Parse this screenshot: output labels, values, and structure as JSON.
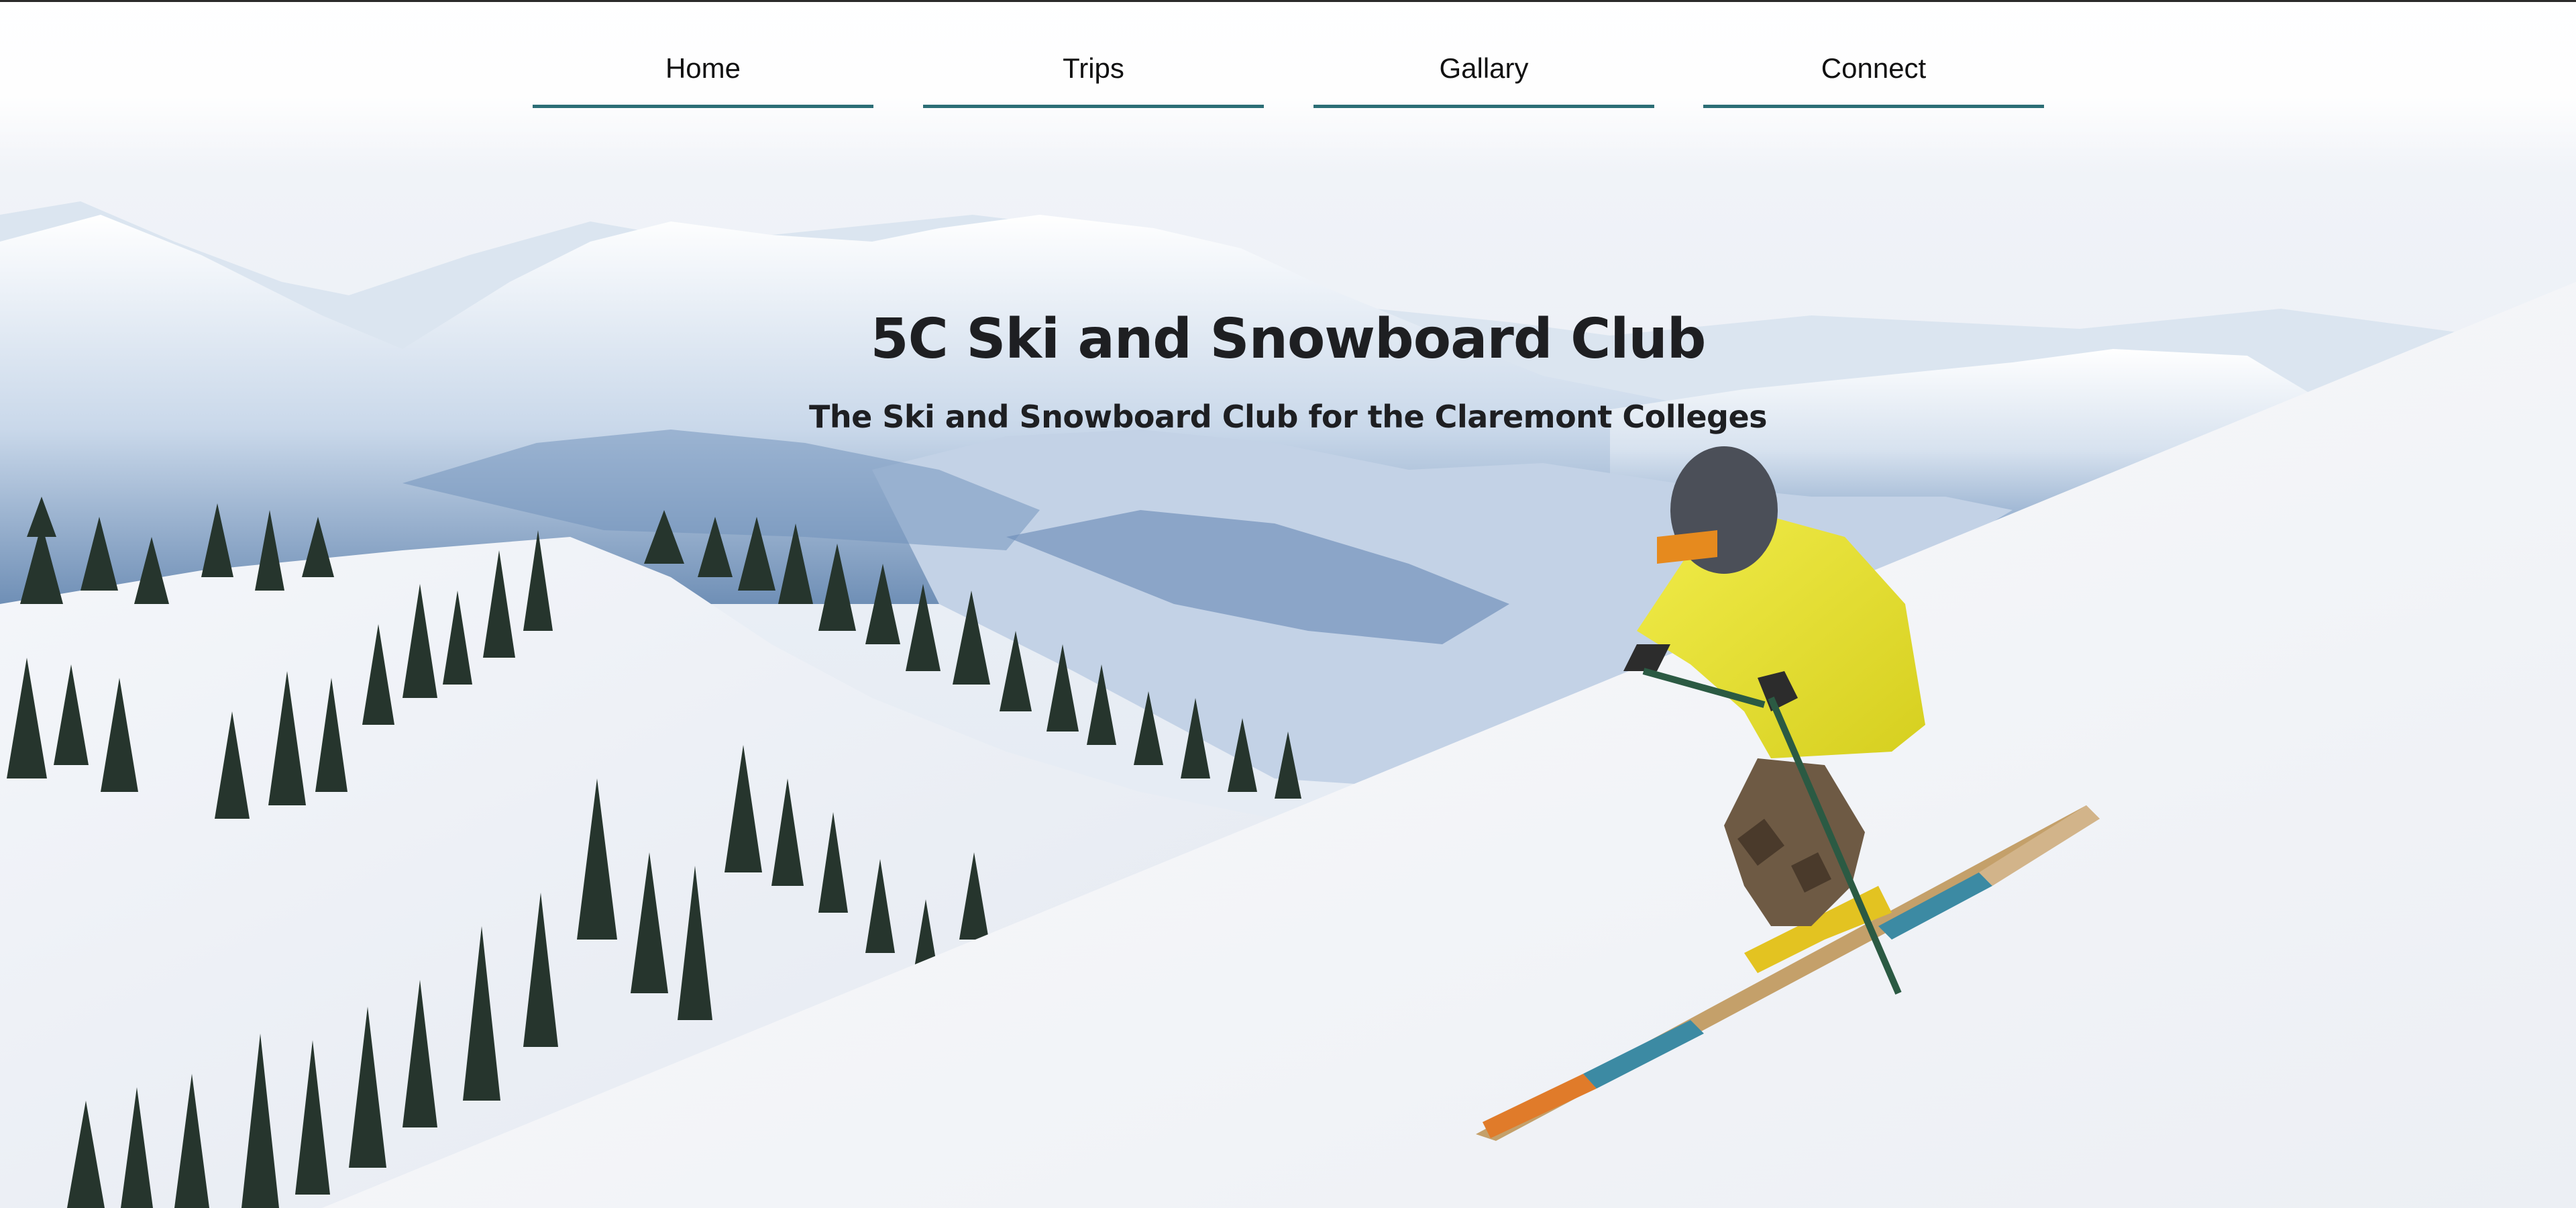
{
  "nav": {
    "items": [
      {
        "label": "Home"
      },
      {
        "label": "Trips"
      },
      {
        "label": "Gallary"
      },
      {
        "label": "Connect"
      }
    ],
    "underline_color": "#2c6e76"
  },
  "hero": {
    "title": "5C Ski and Snowboard Club",
    "subtitle": "The Ski and Snowboard Club for the Claremont Colleges",
    "image": "skier-on-snowy-mountain-slope"
  }
}
